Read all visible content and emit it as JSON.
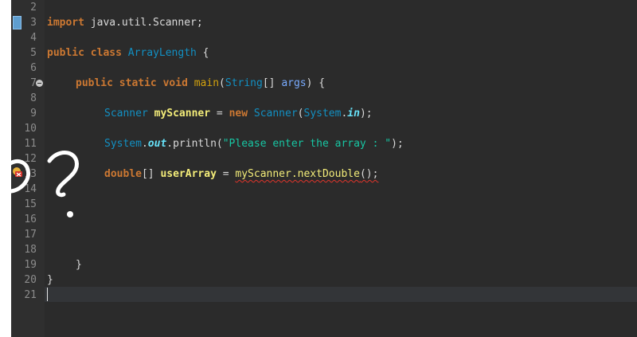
{
  "gutter": {
    "line_numbers": [
      "2",
      "3",
      "4",
      "5",
      "6",
      "7",
      "8",
      "9",
      "10",
      "11",
      "12",
      "13",
      "14",
      "15",
      "16",
      "17",
      "18",
      "19",
      "20",
      "21"
    ]
  },
  "code": {
    "import_kw": "import",
    "import_pkg": " java.util.Scanner;",
    "public1": "public",
    "class_kw": "class",
    "class_name": "ArrayLength",
    "brace_open": " {",
    "public2": "public",
    "static_kw": "static",
    "void_kw": "void",
    "main_name": "main",
    "paren_open": "(",
    "string_type": "String",
    "arr_brackets": "[] ",
    "args_param": "args",
    "paren_close_brace": ") {",
    "scanner_type": "Scanner",
    "myscanner_var": "myScanner",
    "equals": " = ",
    "new_kw": "new",
    "scanner_ctor": "Scanner",
    "ctor_open": "(",
    "system_cls": "System",
    "dot": ".",
    "in_field": "in",
    "ctor_close": ");",
    "system_cls2": "System",
    "out_field": "out",
    "println": "println",
    "println_open": "(",
    "prompt_str": "\"Please enter the array : \"",
    "println_close": ");",
    "double_kw": "double",
    "arr2": "[] ",
    "userarray_var": "userArray",
    "eq2": " = ",
    "myscanner_ref": "myScanner.nextDouble",
    "call_close": "();",
    "close_method": "}",
    "close_class": "}"
  },
  "colors": {
    "background": "#2b2b2b",
    "keyword": "#cc7832",
    "class_name": "#1290c3",
    "string": "#17c6a3",
    "error_underline": "#e0342a"
  },
  "icons": {
    "bookmark": "bookmark-marker-icon",
    "error": "error-marker-icon",
    "fold": "fold-collapse-icon"
  }
}
